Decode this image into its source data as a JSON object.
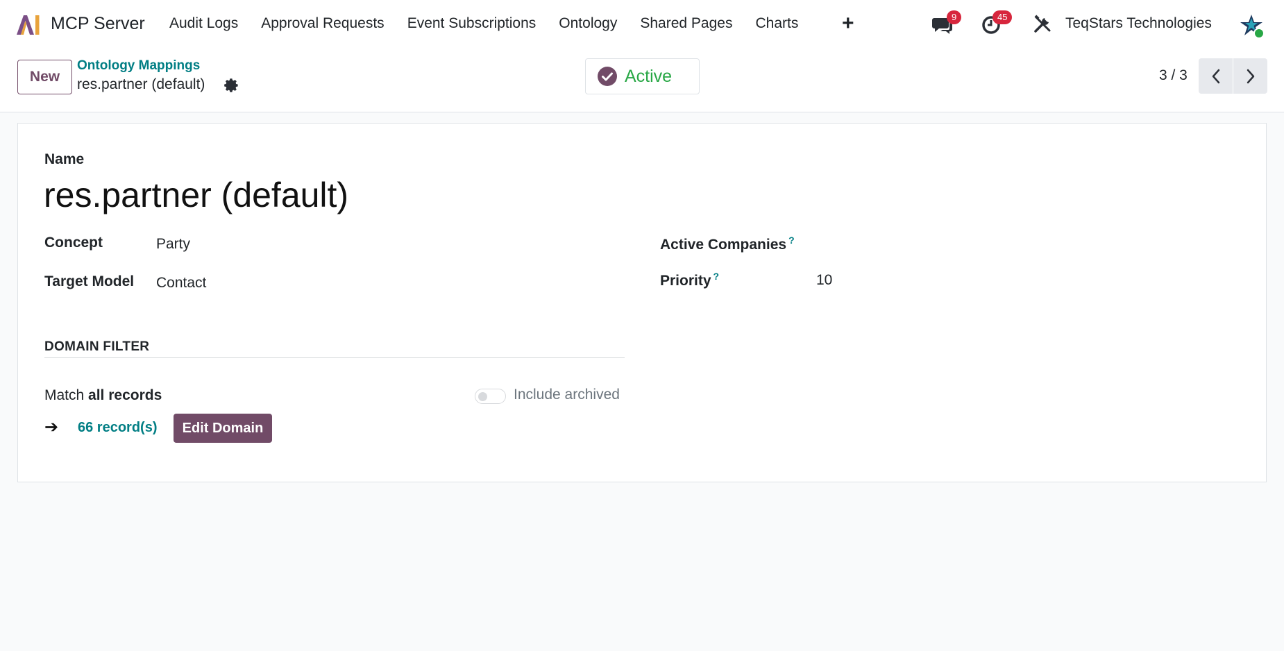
{
  "navbar": {
    "app_name": "MCP Server",
    "menu": [
      "Audit Logs",
      "Approval Requests",
      "Event Subscriptions",
      "Ontology",
      "Shared Pages",
      "Charts"
    ],
    "add_icon": "plus-icon",
    "messages_count": "9",
    "activities_count": "45",
    "company": "TeqStars Technologies",
    "colors": {
      "badge": "#d7263d",
      "brand": "#714b67",
      "link": "#017e84",
      "active_status": "#28a745"
    }
  },
  "control_panel": {
    "new_label": "New",
    "breadcrumb_parent": "Ontology Mappings",
    "breadcrumb_current": "res.partner (default)",
    "status_label": "Active",
    "pager_value": "3 / 3"
  },
  "form": {
    "name_label": "Name",
    "name_value": "res.partner (default)",
    "concept_label": "Concept",
    "concept_value": "Party",
    "target_model_label": "Target Model",
    "target_model_value": "Contact",
    "active_companies_label": "Active Companies",
    "active_companies_help": "?",
    "priority_label": "Priority",
    "priority_help": "?",
    "priority_value": "10",
    "domain_section_title": "DOMAIN FILTER",
    "match_prefix": "Match",
    "match_value": "all records",
    "include_archived_label": "Include archived",
    "records_link": "66 record(s)",
    "edit_domain_label": "Edit Domain"
  }
}
